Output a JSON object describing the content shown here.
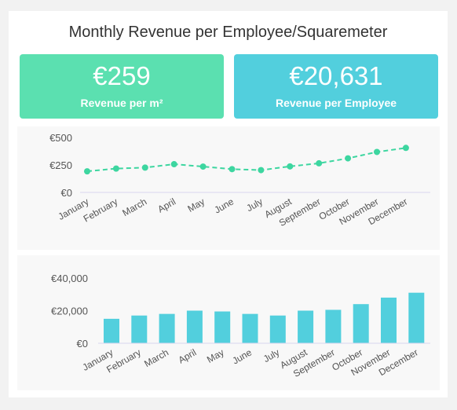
{
  "title": "Monthly Revenue per Employee/Squaremeter",
  "colors": {
    "green": "#5be0b0",
    "cyan": "#52cfdd",
    "line": "#3dd6a0",
    "bar": "#52cfdd"
  },
  "kpis": [
    {
      "value": "€259",
      "label": "Revenue per m²"
    },
    {
      "value": "€20,631",
      "label": "Revenue per Employee"
    }
  ],
  "chart_data": [
    {
      "type": "line",
      "categories": [
        "January",
        "February",
        "March",
        "April",
        "May",
        "June",
        "July",
        "August",
        "September",
        "October",
        "November",
        "December"
      ],
      "values": [
        192,
        217,
        226,
        257,
        235,
        212,
        203,
        237,
        265,
        310,
        368,
        405
      ],
      "ylim": [
        0,
        500
      ],
      "yticks": [
        {
          "v": 0,
          "label": "€0"
        },
        {
          "v": 250,
          "label": "€250"
        },
        {
          "v": 500,
          "label": "€500"
        }
      ],
      "style": "dashed-with-markers"
    },
    {
      "type": "bar",
      "categories": [
        "January",
        "February",
        "March",
        "April",
        "May",
        "June",
        "July",
        "August",
        "September",
        "October",
        "November",
        "December"
      ],
      "values": [
        15000,
        17000,
        18000,
        20000,
        19500,
        18000,
        17000,
        20000,
        20500,
        24000,
        28000,
        31000
      ],
      "ylim": [
        0,
        40000
      ],
      "yticks": [
        {
          "v": 0,
          "label": "€0"
        },
        {
          "v": 20000,
          "label": "€20,000"
        },
        {
          "v": 40000,
          "label": "€40,000"
        }
      ]
    }
  ]
}
